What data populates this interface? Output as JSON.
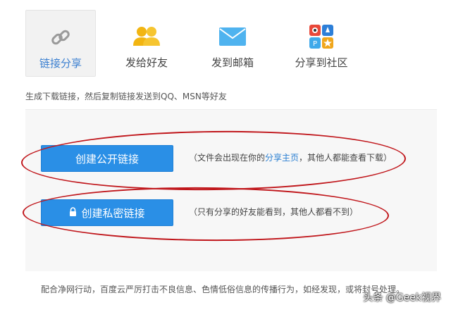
{
  "tabs": [
    {
      "label": "链接分享",
      "icon": "chain-link-icon",
      "active": true
    },
    {
      "label": "发给好友",
      "icon": "friends-icon",
      "active": false
    },
    {
      "label": "发到邮箱",
      "icon": "envelope-icon",
      "active": false
    },
    {
      "label": "分享到社区",
      "icon": "community-apps-icon",
      "active": false
    }
  ],
  "description": "生成下载链接，然后复制链接发送到QQ、MSN等好友",
  "public_link": {
    "button_label": "创建公开链接",
    "hint_prefix": "（文件会出现在你的",
    "hint_link": "分享主页",
    "hint_suffix": "，其他人都能查看下载）"
  },
  "private_link": {
    "button_label": "创建私密链接",
    "hint": "（只有分享的好友能看到，其他人都看不到）"
  },
  "footer_notice": "配合净网行动，百度云严厉打击不良信息、色情低俗信息的传播行为，如经发现，或将封号处理。",
  "watermark": "头条 @Geek视界",
  "colors": {
    "accent": "#2a8fe6",
    "active_tab_text": "#3a7fd0",
    "annotation_red": "#c0161b"
  }
}
